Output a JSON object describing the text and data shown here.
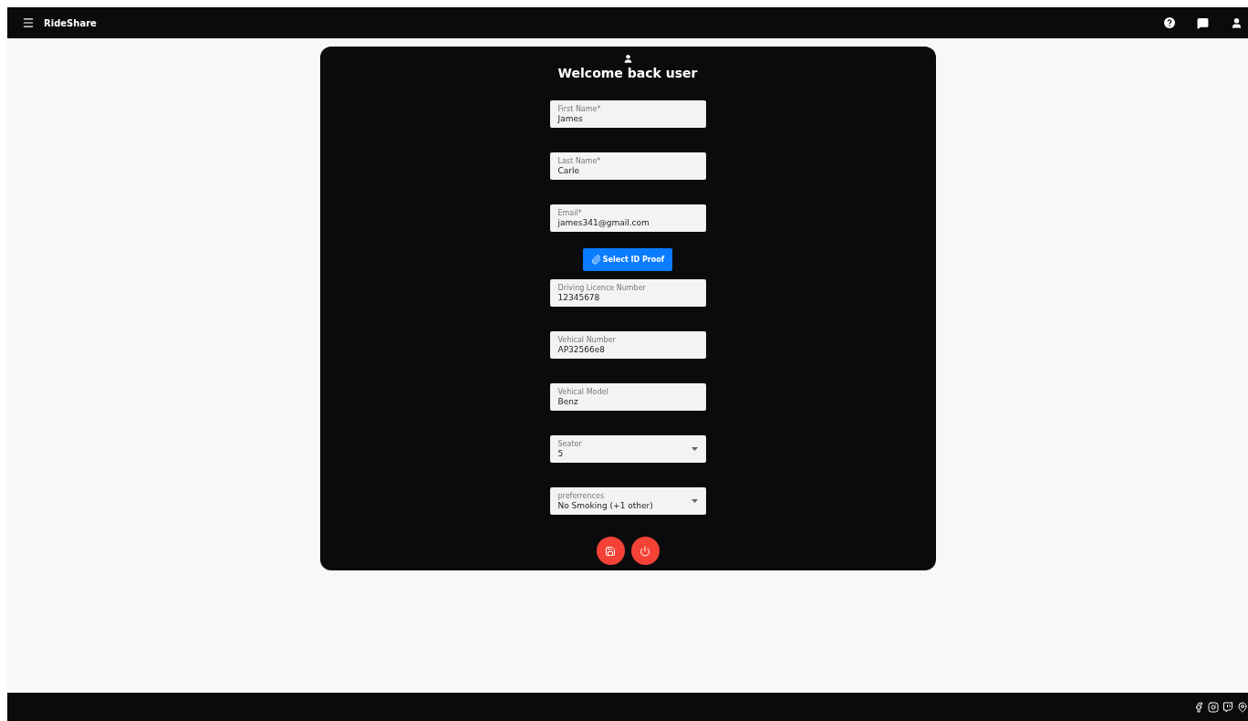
{
  "app_bar": {
    "title": "RideShare"
  },
  "card": {
    "title": "Welcome back user",
    "fields": [
      {
        "kind": "text",
        "label": "First Name*",
        "value": "James"
      },
      {
        "kind": "text",
        "label": "Last Name*",
        "value": "Carle"
      },
      {
        "kind": "text",
        "label": "Email*",
        "value": "james341@gmail.com"
      },
      {
        "kind": "upload",
        "label": "Select ID Proof"
      },
      {
        "kind": "text",
        "label": "Driving Licence Number",
        "value": "12345678"
      },
      {
        "kind": "text",
        "label": "Vehical Number",
        "value": "AP32566e8"
      },
      {
        "kind": "text",
        "label": "Vehical Model",
        "value": "Benz"
      },
      {
        "kind": "select",
        "label": "Seater",
        "value": "5"
      },
      {
        "kind": "select",
        "label": "preferrences",
        "value": "No Smoking (+1 other)"
      }
    ]
  }
}
